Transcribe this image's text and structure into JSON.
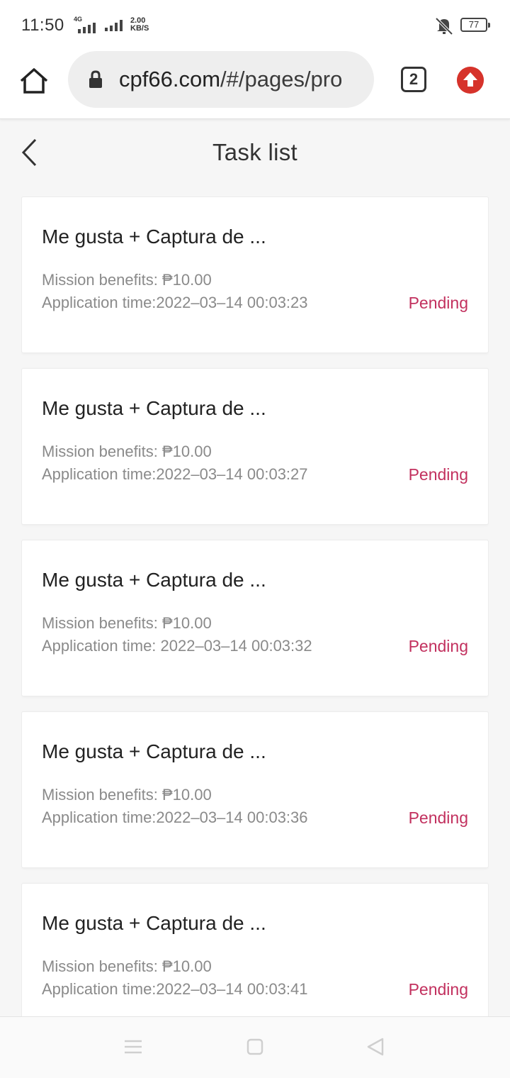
{
  "status_bar": {
    "time": "11:50",
    "network_type": "4G",
    "net_speed_value": "2.00",
    "net_speed_unit": "KB/S",
    "battery_level": "77"
  },
  "browser": {
    "url_host": "cpf66.com",
    "url_path": "/#/pages/pro",
    "tab_count": "2"
  },
  "page": {
    "title": "Task list"
  },
  "tasks": [
    {
      "title": "Me gusta + Captura de ...",
      "benefits": "Mission benefits: ₱10.00",
      "time": "Application time:2022–03–14 00:03:23",
      "status": "Pending"
    },
    {
      "title": "Me gusta + Captura de ...",
      "benefits": "Mission benefits: ₱10.00",
      "time": "Application time:2022–03–14 00:03:27",
      "status": "Pending"
    },
    {
      "title": "Me gusta + Captura de ...",
      "benefits": "Mission benefits: ₱10.00",
      "time": "Application time: 2022–03–14 00:03:32",
      "status": "Pending"
    },
    {
      "title": "Me gusta + Captura de ...",
      "benefits": "Mission benefits: ₱10.00",
      "time": "Application time:2022–03–14 00:03:36",
      "status": "Pending"
    },
    {
      "title": "Me gusta + Captura de ...",
      "benefits": "Mission benefits: ₱10.00",
      "time": "Application time:2022–03–14 00:03:41",
      "status": "Pending"
    }
  ],
  "colors": {
    "status_pending": "#c2305e",
    "update_button": "#d6332b"
  },
  "icons": {
    "browser": [
      "home-icon",
      "lock-icon",
      "tabs-icon",
      "update-icon"
    ],
    "status": [
      "signal-icon",
      "mute-icon",
      "battery-icon"
    ],
    "nav": [
      "menu-icon",
      "home-square-icon",
      "back-triangle-icon"
    ]
  }
}
